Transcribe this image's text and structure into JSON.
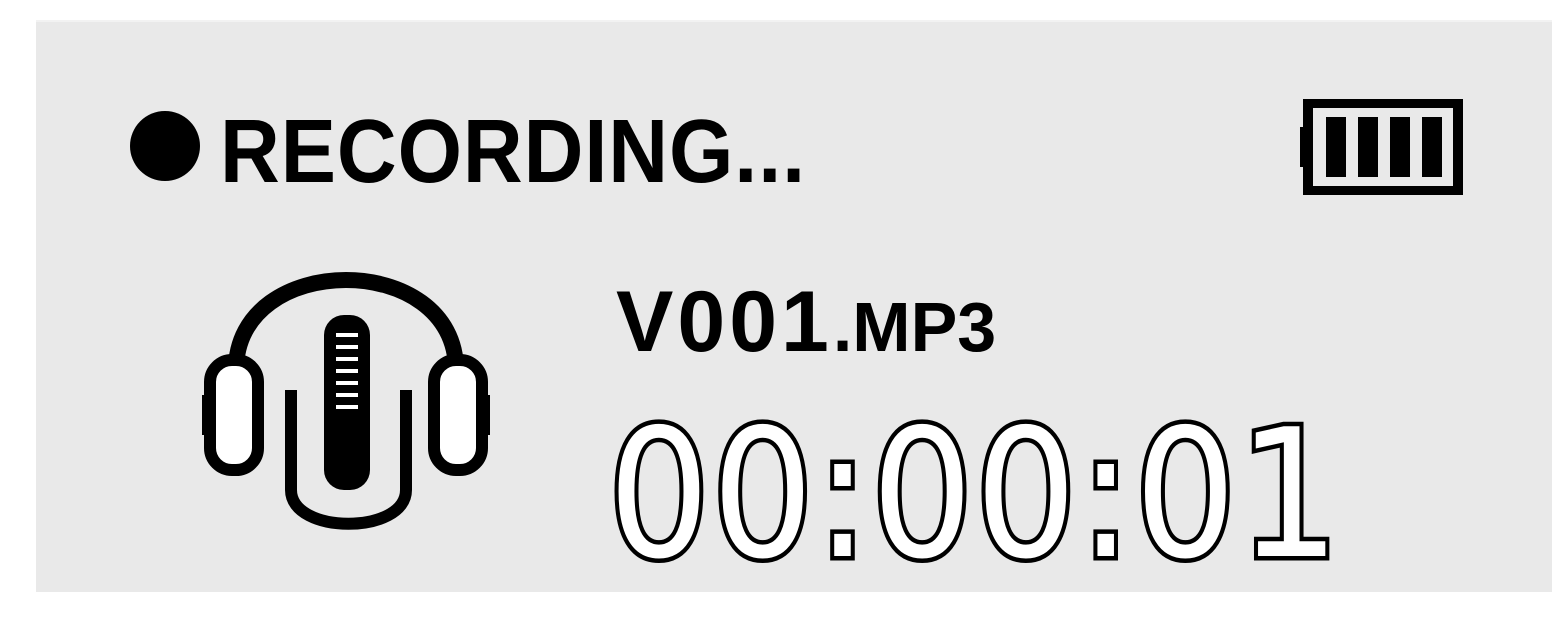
{
  "status": {
    "label": "RECORDING...",
    "indicator_icon": "record-dot-icon"
  },
  "battery": {
    "icon": "battery-icon",
    "level_bars": 4,
    "max_bars": 4
  },
  "file": {
    "name_base": "V001",
    "name_ext": ".MP3",
    "icon": "headset-mic-icon"
  },
  "timer": {
    "elapsed": "00:00:01"
  },
  "colors": {
    "display_bg": "#e9e9e9",
    "ink": "#000000"
  }
}
